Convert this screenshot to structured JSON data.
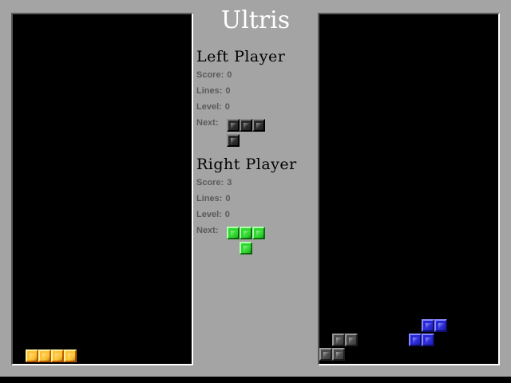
{
  "game_title": "Ultris",
  "left_player": {
    "title": "Left Player",
    "score_label": "Score:",
    "score": "0",
    "lines_label": "Lines:",
    "lines": "0",
    "level_label": "Level:",
    "level": "0",
    "next_label": "Next:",
    "next_piece": "L",
    "next_color": "#2a2a2a"
  },
  "right_player": {
    "title": "Right Player",
    "score_label": "Score:",
    "score": "3",
    "lines_label": "Lines:",
    "lines": "0",
    "level_label": "Level:",
    "level": "0",
    "next_label": "Next:",
    "next_piece": "T",
    "next_color": "#2ed82e"
  },
  "colors": {
    "frame": "#a4a4a4",
    "well": "#000000",
    "title": "#ffffff"
  },
  "left_board": {
    "pieces": [
      "I-yellow"
    ]
  },
  "right_board": {
    "pieces": [
      "S-blue",
      "S-gray"
    ]
  }
}
